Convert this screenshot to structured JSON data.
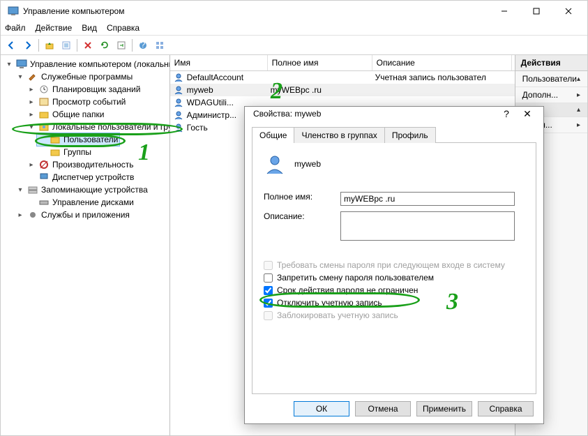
{
  "window": {
    "title": "Управление компьютером",
    "min": "—",
    "max": "▢",
    "close": "✕"
  },
  "menubar": [
    "Файл",
    "Действие",
    "Вид",
    "Справка"
  ],
  "tree": {
    "root": "Управление компьютером (локальным)",
    "sys": "Служебные программы",
    "sched": "Планировщик заданий",
    "event": "Просмотр событий",
    "shared": "Общие папки",
    "localusers": "Локальные пользователи и группы",
    "users": "Пользователи",
    "groups": "Группы",
    "perf": "Производительность",
    "devmgr": "Диспетчер устройств",
    "storage": "Запоминающие устройства",
    "diskmgr": "Управление дисками",
    "svcapp": "Службы и приложения"
  },
  "list": {
    "cols": {
      "name": "Имя",
      "full": "Полное имя",
      "desc": "Описание"
    },
    "rows": [
      {
        "name": "DefaultAccount",
        "full": "",
        "desc": "Учетная запись пользовател"
      },
      {
        "name": "myweb",
        "full": "myWEBpc .ru",
        "desc": ""
      },
      {
        "name": "WDAGUtili...",
        "full": "",
        "desc": ""
      },
      {
        "name": "Администр...",
        "full": "",
        "desc": ""
      },
      {
        "name": "Гость",
        "full": "",
        "desc": ""
      }
    ]
  },
  "actions": {
    "header": "Действия",
    "items": [
      "Пользователи",
      "Дополн..."
    ],
    "more": "ополн..."
  },
  "dialog": {
    "title": "Свойства: myweb",
    "help": "?",
    "close": "✕",
    "tabs": {
      "general": "Общие",
      "member": "Членство в группах",
      "profile": "Профиль"
    },
    "username": "myweb",
    "fields": {
      "fullname_label": "Полное имя:",
      "fullname_value": "myWEBpc .ru",
      "desc_label": "Описание:",
      "desc_value": ""
    },
    "checks": {
      "mustchange": "Требовать смены пароля при следующем входе в систему",
      "cannotchange": "Запретить смену пароля пользователем",
      "neverexpires": "Срок действия пароля не ограничен",
      "disabled": "Отключить учетную запись",
      "locked": "Заблокировать учетную запись"
    },
    "buttons": {
      "ok": "ОК",
      "cancel": "Отмена",
      "apply": "Применить",
      "help": "Справка"
    }
  }
}
